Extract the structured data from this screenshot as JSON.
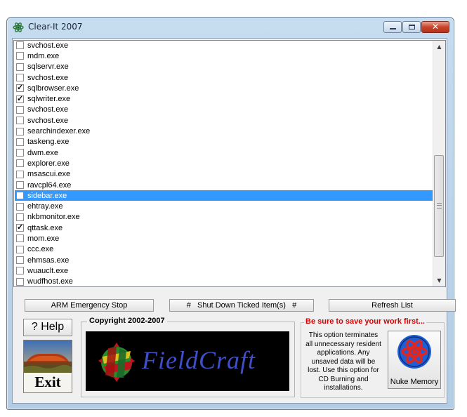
{
  "window": {
    "title": "Clear-It 2007",
    "caption_buttons": {
      "minimize": "minimize",
      "maximize": "maximize",
      "close": "✕"
    }
  },
  "process_list": [
    {
      "name": "svchost.exe",
      "checked": false,
      "selected": false
    },
    {
      "name": "mdm.exe",
      "checked": false,
      "selected": false
    },
    {
      "name": "sqlservr.exe",
      "checked": false,
      "selected": false
    },
    {
      "name": "svchost.exe",
      "checked": false,
      "selected": false
    },
    {
      "name": "sqlbrowser.exe",
      "checked": true,
      "selected": false
    },
    {
      "name": "sqlwriter.exe",
      "checked": true,
      "selected": false
    },
    {
      "name": "svchost.exe",
      "checked": false,
      "selected": false
    },
    {
      "name": "svchost.exe",
      "checked": false,
      "selected": false
    },
    {
      "name": "searchindexer.exe",
      "checked": false,
      "selected": false
    },
    {
      "name": "taskeng.exe",
      "checked": false,
      "selected": false
    },
    {
      "name": "dwm.exe",
      "checked": false,
      "selected": false
    },
    {
      "name": "explorer.exe",
      "checked": false,
      "selected": false
    },
    {
      "name": "msascui.exe",
      "checked": false,
      "selected": false
    },
    {
      "name": "ravcpl64.exe",
      "checked": false,
      "selected": false
    },
    {
      "name": "sidebar.exe",
      "checked": false,
      "selected": true
    },
    {
      "name": "ehtray.exe",
      "checked": false,
      "selected": false
    },
    {
      "name": "nkbmonitor.exe",
      "checked": false,
      "selected": false
    },
    {
      "name": "qttask.exe",
      "checked": true,
      "selected": false
    },
    {
      "name": "mom.exe",
      "checked": false,
      "selected": false
    },
    {
      "name": "ccc.exe",
      "checked": false,
      "selected": false
    },
    {
      "name": "ehmsas.exe",
      "checked": false,
      "selected": false
    },
    {
      "name": "wuauclt.exe",
      "checked": false,
      "selected": false
    },
    {
      "name": "wudfhost.exe",
      "checked": false,
      "selected": false
    }
  ],
  "buttons": {
    "arm_emergency_stop": "ARM  Emergency Stop",
    "shut_down_ticked": "#   Shut Down Ticked Item(s)   #",
    "refresh_list": "Refresh List",
    "help": "? Help",
    "exit": "Exit",
    "nuke_memory": "Nuke Memory"
  },
  "copyright": {
    "title": "Copyright 2002-2007",
    "logo_text": "FieldCraft"
  },
  "nuke": {
    "title": "Be sure to save your work first...",
    "description": "This option terminates all unnecessary resident applications. Any unsaved data will be lost. Use this option for CD Burning and installations."
  },
  "colors": {
    "selection": "#3399ff",
    "warning_text": "#d80000",
    "logo_text": "#3e4fc8",
    "nuke_icon_red": "#e0261f",
    "nuke_icon_blue": "#1f5fd6"
  },
  "icons": {
    "title": "atom-app-icon",
    "scroll_up": "▲",
    "scroll_down": "▼",
    "exit_image": "uluru-landscape",
    "logo": "fieldcraft-ball-logo",
    "nuke": "atom-icon"
  }
}
